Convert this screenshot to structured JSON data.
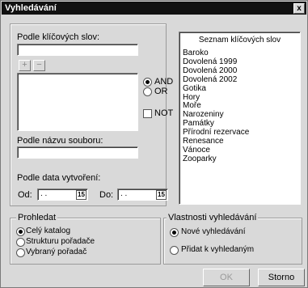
{
  "window": {
    "title": "Vyhledávání",
    "close": "x"
  },
  "keywords": {
    "label": "Podle klíčových slov:",
    "input_value": "",
    "add": "+",
    "remove": "−",
    "and_label": "AND",
    "or_label": "OR",
    "not_label": "NOT",
    "logic_selected": "AND"
  },
  "filename": {
    "label": "Podle názvu souboru:",
    "value": ""
  },
  "date": {
    "label": "Podle data vytvoření:",
    "from_label": "Od:",
    "from_value": " .  .",
    "to_label": "Do:",
    "to_value": " .  .",
    "cal_glyph": "15"
  },
  "keyword_list": {
    "title": "Seznam klíčových slov",
    "items": [
      "Baroko",
      "Dovolená 1999",
      "Dovolená 2000",
      "Dovolená 2002",
      "Gotika",
      "Hory",
      "Moře",
      "Narozeniny",
      "Památky",
      "Přírodní rezervace",
      "Renesance",
      "Vánoce",
      "Zooparky"
    ]
  },
  "search_scope": {
    "title": "Prohledat",
    "options": [
      "Celý katalog",
      "Strukturu pořadače",
      "Vybraný pořadač"
    ],
    "selected": "Celý katalog"
  },
  "search_props": {
    "title": "Vlastnosti vyhledávání",
    "options": [
      "Nové vyhledávání",
      "Přidat k vyhledaným"
    ],
    "selected": "Nové vyhledávání"
  },
  "buttons": {
    "ok": "OK",
    "cancel": "Storno"
  }
}
